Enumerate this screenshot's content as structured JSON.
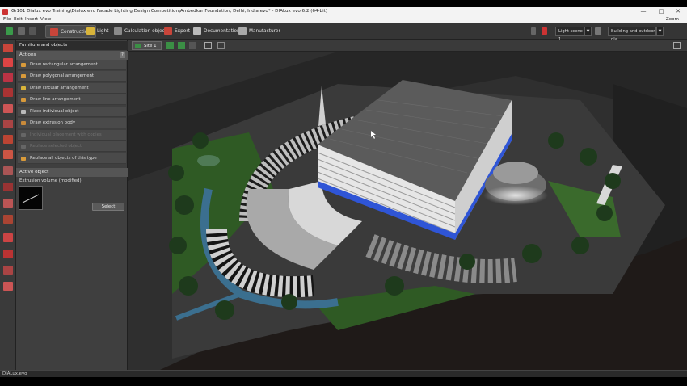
{
  "window": {
    "title": "Gr101 Dialux evo Training\\Dialux evo Facade Lighting Design Competition\\Ambedkar Foundation, Delhi, India.evo* - DIALux evo 6.2 (64-bit)",
    "minimize": "—",
    "maximize": "□",
    "close": "✕"
  },
  "menu": {
    "items": [
      "File",
      "Edit",
      "Insert",
      "View"
    ],
    "zoom_label": "Zoom"
  },
  "toolbar": {
    "tabs": [
      {
        "label": "Construction",
        "icon": "construction-icon"
      },
      {
        "label": "Light",
        "icon": "light-icon"
      },
      {
        "label": "Calculation objects",
        "icon": "calculation-objects-icon"
      },
      {
        "label": "Export",
        "icon": "export-icon"
      },
      {
        "label": "Documentation",
        "icon": "documentation-icon"
      },
      {
        "label": "Manufacturer",
        "icon": "manufacturer-icon"
      }
    ],
    "light_scene": "Light scene 1",
    "view_mode": "Building and outdoor pla"
  },
  "panel": {
    "title": "Furniture and objects",
    "help": "?",
    "actions_header": "Actions",
    "actions": [
      {
        "label": "Draw rectangular arrangement",
        "enabled": true
      },
      {
        "label": "Draw polygonal arrangement",
        "enabled": true
      },
      {
        "label": "Draw circular arrangement",
        "enabled": true
      },
      {
        "label": "Draw line arrangement",
        "enabled": true
      },
      {
        "label": "Place individual object",
        "enabled": true
      },
      {
        "label": "Draw extrusion body",
        "enabled": true
      },
      {
        "label": "Individual placement with copies",
        "enabled": false
      },
      {
        "label": "Replace selected object",
        "enabled": false
      },
      {
        "label": "Replace all objects of this type",
        "enabled": true
      }
    ],
    "active_object_header": "Active object",
    "active_object_name": "Extrusion volume (modified)",
    "select_button": "Select"
  },
  "viewbar": {
    "site_tab": "Site 1"
  },
  "status": {
    "text": "DIALux.evo"
  },
  "colors": {
    "accent_blue": "#2f55d6",
    "grass": "#3a6a2c",
    "tab_active": "#4a4a4a"
  }
}
